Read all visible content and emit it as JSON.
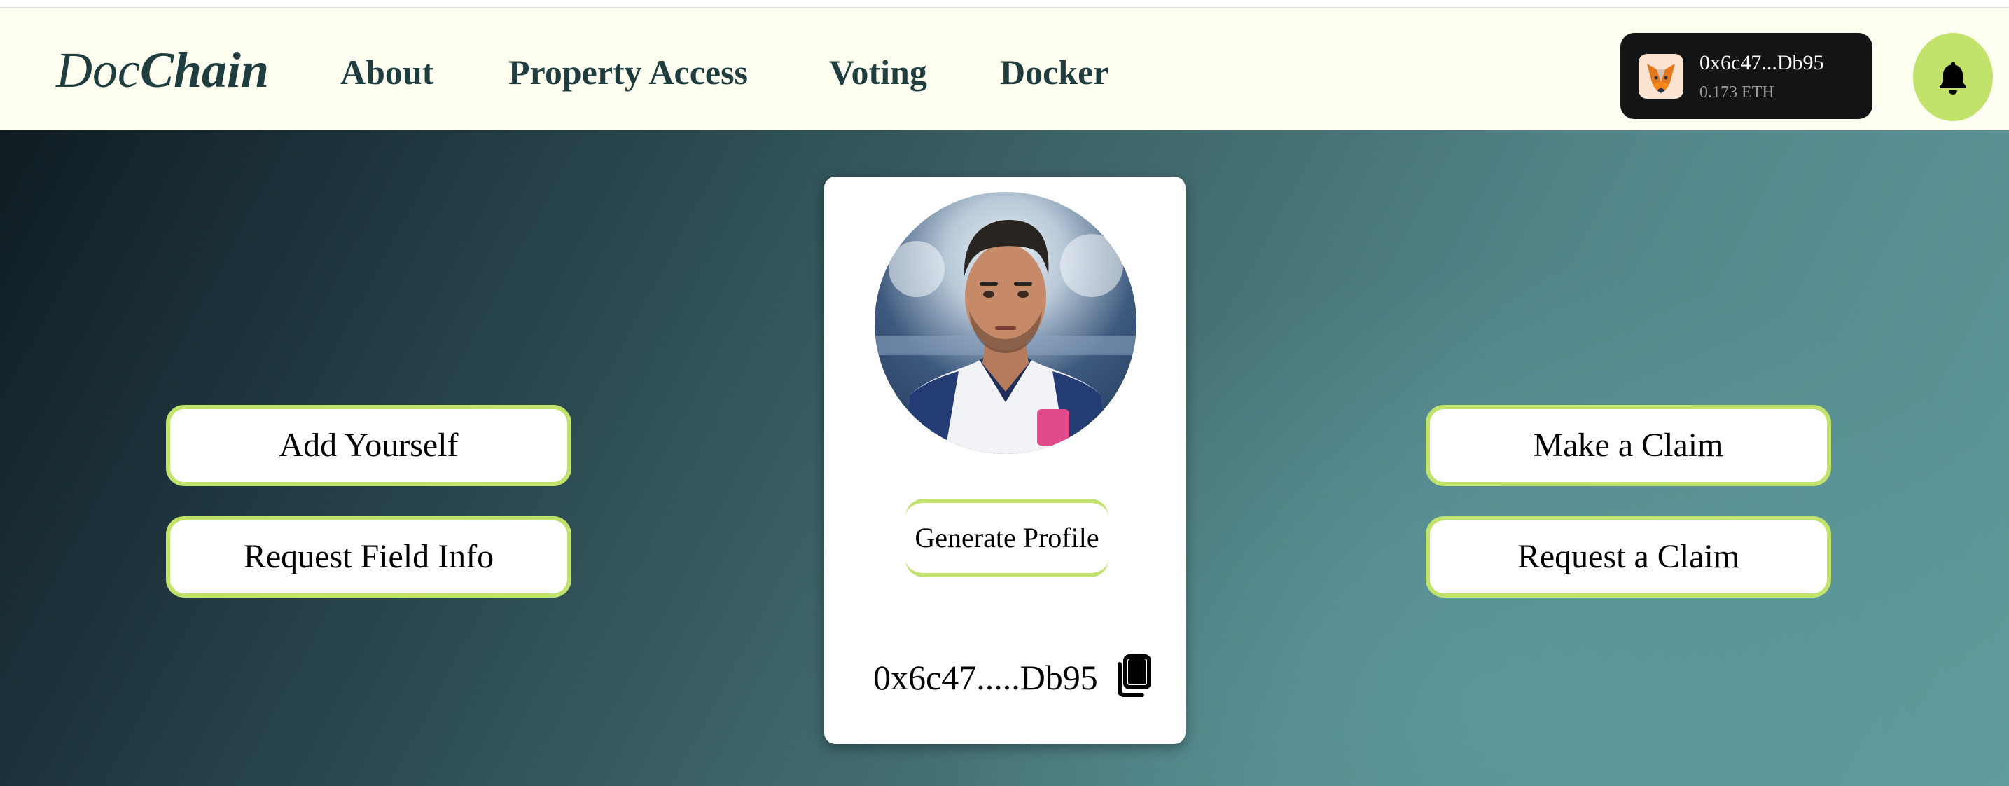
{
  "brand": {
    "doc": "Doc",
    "chain": "Chain"
  },
  "nav": {
    "about": "About",
    "property_access": "Property Access",
    "voting": "Voting",
    "docker": "Docker"
  },
  "wallet": {
    "address": "0x6c47...Db95",
    "balance": "0.173 ETH",
    "icon": "metamask-fox-icon"
  },
  "notifications": {
    "icon": "bell-icon"
  },
  "actions": {
    "add_yourself": "Add Yourself",
    "request_field_info": "Request Field Info",
    "make_claim": "Make a Claim",
    "request_claim": "Request a Claim"
  },
  "profile": {
    "generate_label": "Generate Profile",
    "address": "0x6c47.....Db95",
    "copy_icon": "copy-icon"
  },
  "colors": {
    "accent": "#c2e36b",
    "nav_text": "#1f3d3f",
    "navbar_bg": "#fefff0",
    "wallet_bg": "#121416"
  }
}
